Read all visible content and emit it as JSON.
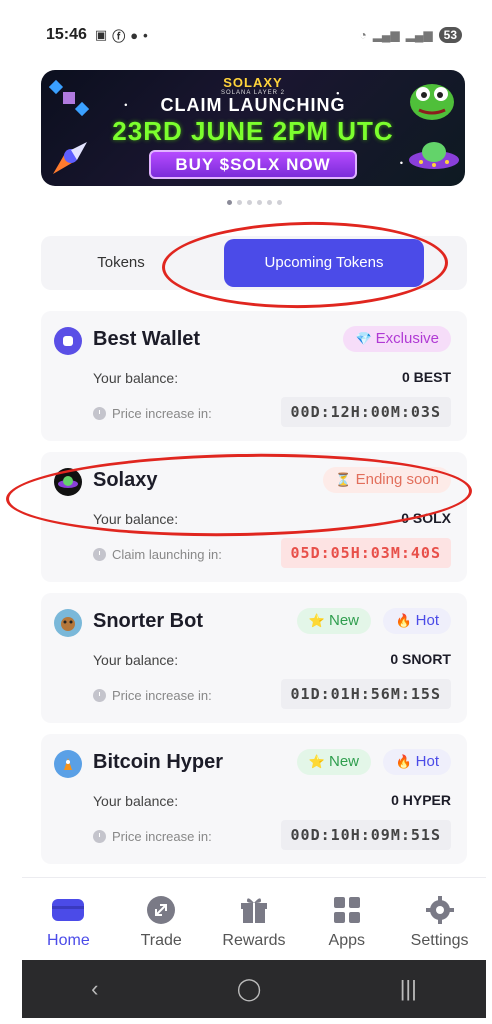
{
  "status_bar": {
    "time": "15:46",
    "battery": "53"
  },
  "banner": {
    "brand": "SOLAXY",
    "brand_sub": "SOLANA LAYER 2",
    "line1": "CLAIM LAUNCHING",
    "line2": "23RD JUNE 2PM UTC",
    "cta": "BUY $SOLX NOW"
  },
  "carousel": {
    "total": 6,
    "active_index": 0
  },
  "tabs": {
    "tokens": "Tokens",
    "upcoming": "Upcoming Tokens",
    "selected": "upcoming"
  },
  "cards": [
    {
      "name": "Best Wallet",
      "badges": [
        {
          "label": "Exclusive",
          "icon": "diamond-icon"
        }
      ],
      "balance_label": "Your balance:",
      "balance_value": "0 BEST",
      "timer_label": "Price increase in:",
      "timer": "00D:12H:00M:03S"
    },
    {
      "name": "Solaxy",
      "badges": [
        {
          "label": "Ending soon",
          "icon": "hourglass-icon"
        }
      ],
      "balance_label": "Your balance:",
      "balance_value": "0 SOLX",
      "timer_label": "Claim launching in:",
      "timer": "05D:05H:03M:40S"
    },
    {
      "name": "Snorter Bot",
      "badges": [
        {
          "label": "New",
          "icon": "star-icon"
        },
        {
          "label": "Hot",
          "icon": "fire-icon"
        }
      ],
      "balance_label": "Your balance:",
      "balance_value": "0 SNORT",
      "timer_label": "Price increase in:",
      "timer": "01D:01H:56M:15S"
    },
    {
      "name": "Bitcoin Hyper",
      "badges": [
        {
          "label": "New",
          "icon": "star-icon"
        },
        {
          "label": "Hot",
          "icon": "fire-icon"
        }
      ],
      "balance_label": "Your balance:",
      "balance_value": "0 HYPER",
      "timer_label": "Price increase in:",
      "timer": "00D:10H:09M:51S"
    }
  ],
  "bottom_nav": {
    "items": [
      {
        "label": "Home",
        "icon": "wallet-icon",
        "active": true
      },
      {
        "label": "Trade",
        "icon": "swap-icon"
      },
      {
        "label": "Rewards",
        "icon": "gift-icon"
      },
      {
        "label": "Apps",
        "icon": "apps-grid-icon"
      },
      {
        "label": "Settings",
        "icon": "gear-icon"
      }
    ]
  },
  "colors": {
    "accent": "#4b4be8",
    "annotation": "#e0261f",
    "timer_alert": "#e8504a"
  }
}
